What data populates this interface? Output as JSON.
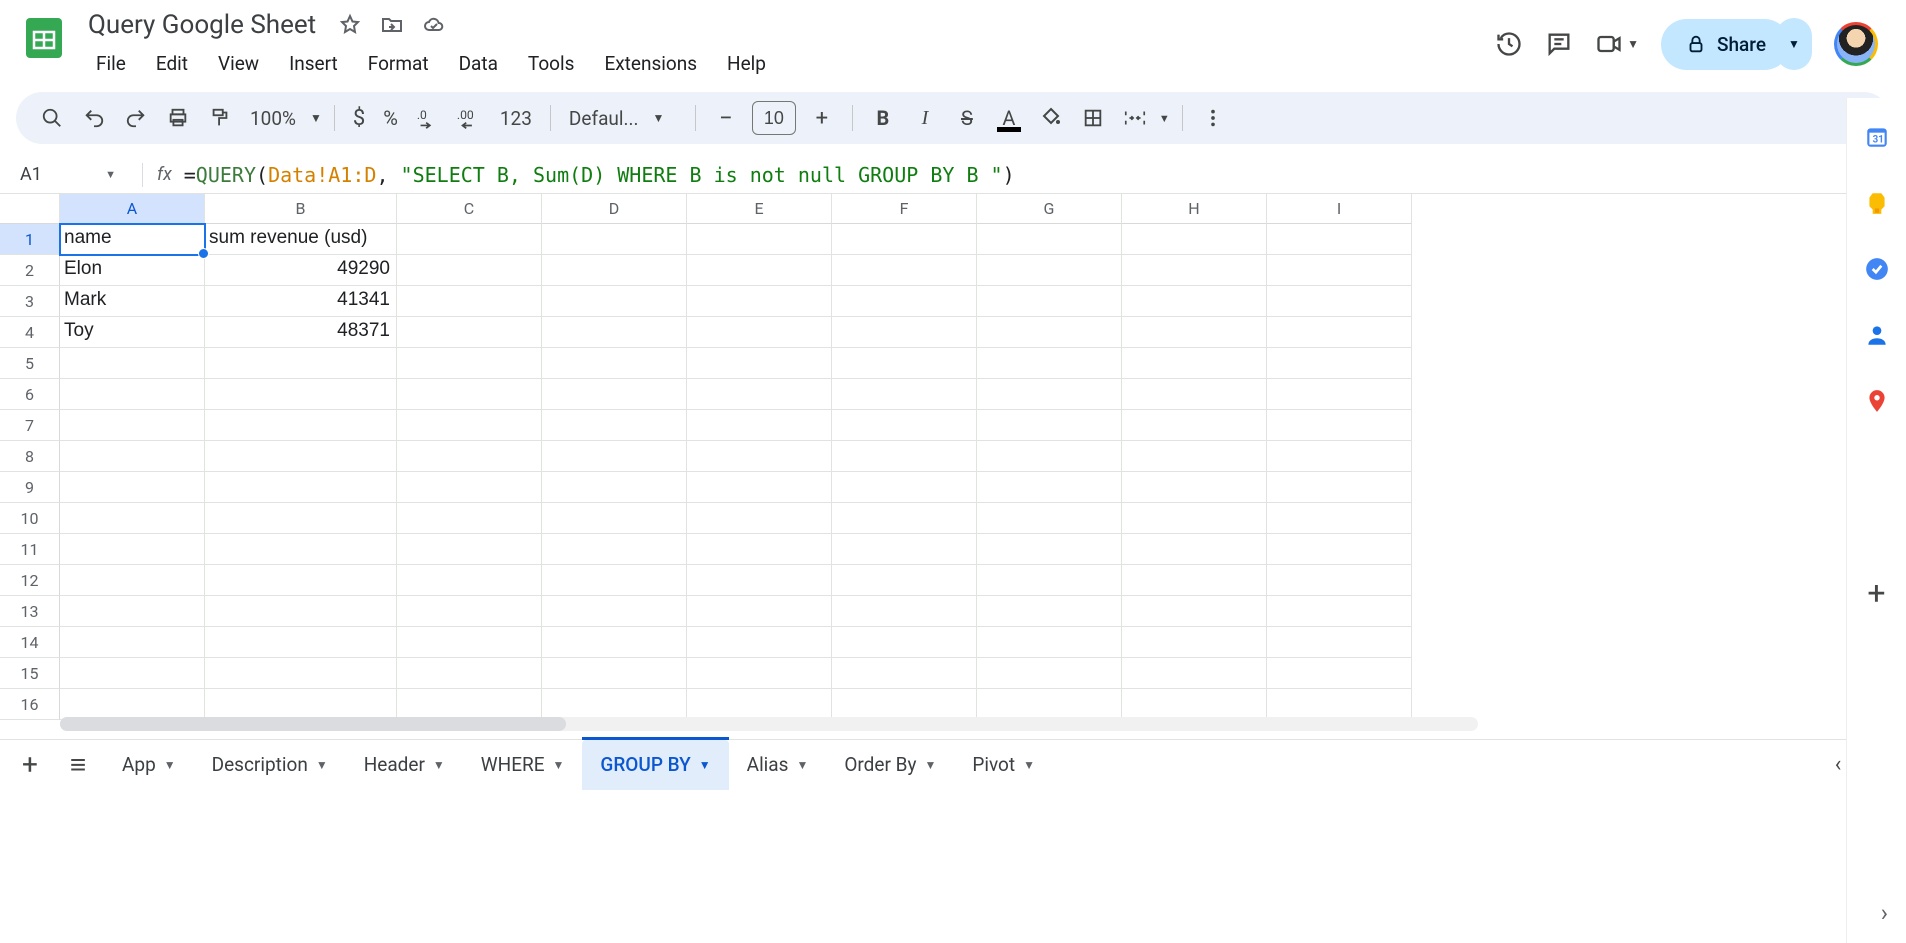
{
  "doc": {
    "title": "Query Google Sheet"
  },
  "menu": {
    "file": "File",
    "edit": "Edit",
    "view": "View",
    "insert": "Insert",
    "format": "Format",
    "data": "Data",
    "tools": "Tools",
    "extensions": "Extensions",
    "help": "Help"
  },
  "share": {
    "label": "Share"
  },
  "toolbar": {
    "zoom": "100%",
    "currency": "$",
    "percent": "%",
    "num123": "123",
    "font": "Defaul...",
    "size": "10"
  },
  "namebox": "A1",
  "formula": {
    "prefix": "=",
    "fn": "QUERY",
    "open": "(",
    "range": "Data!A1:D",
    "comma": ", ",
    "str": "\"SELECT B, Sum(D) WHERE B is not null GROUP BY B \"",
    "close": ")"
  },
  "columns": [
    "A",
    "B",
    "C",
    "D",
    "E",
    "F",
    "G",
    "H",
    "I"
  ],
  "rows": [
    "1",
    "2",
    "3",
    "4",
    "5",
    "6",
    "7",
    "8",
    "9",
    "10",
    "11",
    "12",
    "13",
    "14",
    "15",
    "16"
  ],
  "cells": {
    "A1": "name",
    "B1": "sum revenue (usd)",
    "A2": "Elon",
    "B2": "49290",
    "A3": "Mark",
    "B3": "41341",
    "A4": "Toy",
    "B4": "48371"
  },
  "tabs": [
    {
      "label": "App",
      "partial": true
    },
    {
      "label": "Description"
    },
    {
      "label": "Header"
    },
    {
      "label": "WHERE"
    },
    {
      "label": "GROUP BY",
      "active": true
    },
    {
      "label": "Alias"
    },
    {
      "label": "Order By"
    },
    {
      "label": "Pivot"
    }
  ]
}
